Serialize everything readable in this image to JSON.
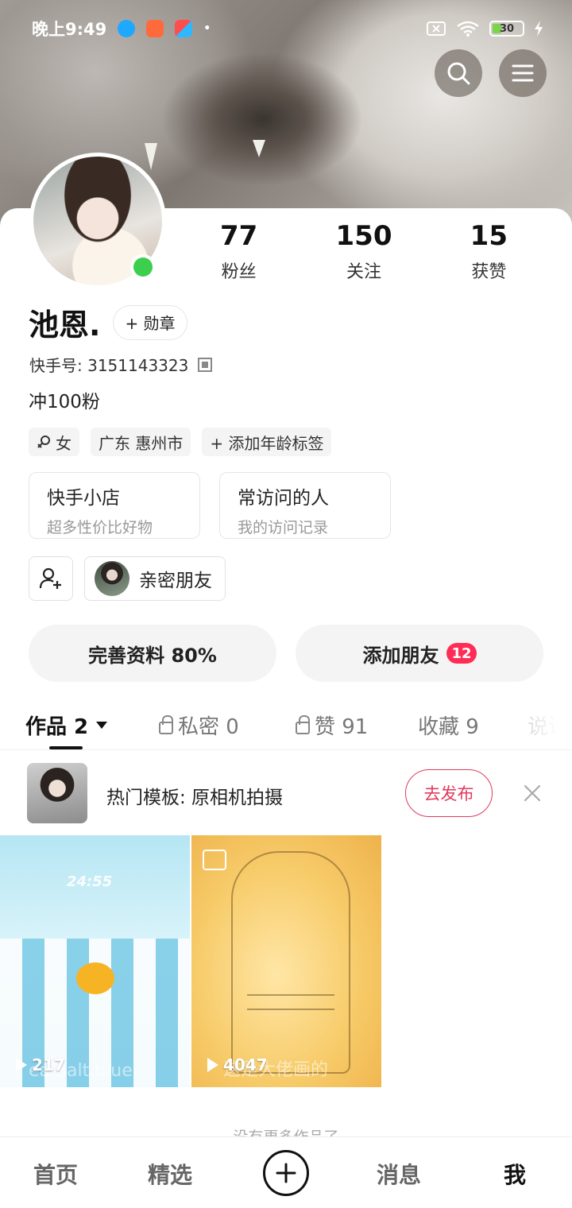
{
  "status_bar": {
    "time": "晚上9:49",
    "battery_level": "30",
    "battery_fraction": 0.3,
    "icons": [
      "browser-icon",
      "mail-app-icon",
      "kuaishou-icon",
      "dot-icon",
      "sim-off-icon",
      "wifi-icon",
      "battery-icon",
      "charging-icon"
    ]
  },
  "header": {
    "icons": [
      "search-icon",
      "menu-icon"
    ]
  },
  "profile": {
    "name": "池恩.",
    "medal_label": "+ 勋章",
    "kuaishou_id_label": "快手号: 3151143323",
    "bio": "冲100粉",
    "online": true,
    "stats": [
      {
        "value": "77",
        "label": "粉丝"
      },
      {
        "value": "150",
        "label": "关注"
      },
      {
        "value": "15",
        "label": "获赞"
      }
    ],
    "tags": [
      {
        "text": "女",
        "icon": "female-icon"
      },
      {
        "text": "广东 惠州市"
      },
      {
        "text": "+ 添加年龄标签"
      }
    ]
  },
  "feature_boxes": [
    {
      "title": "快手小店",
      "subtitle": "超多性价比好物"
    },
    {
      "title": "常访问的人",
      "subtitle": "我的访问记录"
    }
  ],
  "friends": {
    "close_friends_label": "亲密朋友"
  },
  "actions": {
    "complete_profile": "完善资料 80%",
    "add_friends": "添加朋友",
    "add_friends_badge": "12"
  },
  "tabs": [
    {
      "label": "作品 2",
      "active": true
    },
    {
      "label": "私密 0",
      "locked": true
    },
    {
      "label": "赞 91",
      "locked": true
    },
    {
      "label": "收藏 9"
    },
    {
      "label": "说说"
    }
  ],
  "promo": {
    "text": "热门模板: 原相机拍摄",
    "button": "去发布"
  },
  "works": [
    {
      "plays": "217",
      "overlay": "ea.Salt.blue",
      "timer": "24:55"
    },
    {
      "plays": "4047",
      "overlay": "这是大佬画的"
    }
  ],
  "no_more_text": "没有更多作品了",
  "bottom_nav": {
    "home": "首页",
    "featured": "精选",
    "messages": "消息",
    "me": "我",
    "active": "me"
  },
  "colors": {
    "accent": "#ff2d55",
    "publish": "#e03a5c",
    "online": "#3ccf4e"
  }
}
